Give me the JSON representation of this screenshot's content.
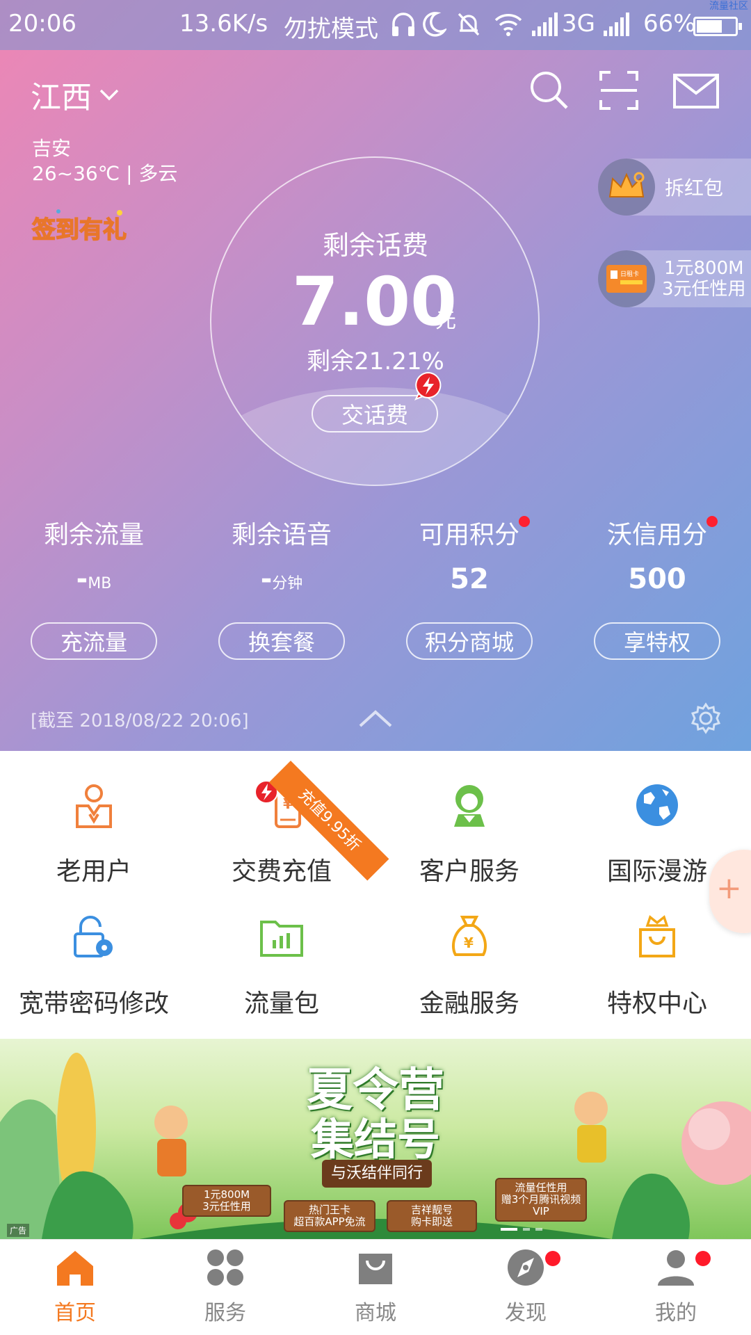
{
  "status_bar": {
    "time": "20:06",
    "net_speed": "13.6K/s",
    "dnd_mode": "勿扰模式",
    "network": "3G",
    "battery_pct": "66%",
    "battery_level": 0.66,
    "corner_tag": "流量社区"
  },
  "header": {
    "province": "江西",
    "city": "吉安",
    "weather": "26~36℃ | 多云",
    "signin_label": "签到有礼"
  },
  "balance": {
    "label": "剩余话费",
    "value": "7.00",
    "unit": "元",
    "remaining": "剩余21.21%",
    "pay_button": "交话费"
  },
  "side_promos": {
    "red_packet": "拆红包",
    "card_line1": "1元800M",
    "card_line2": "3元任性用",
    "card_mini_label": "日租卡"
  },
  "stats": [
    {
      "label": "剩余流量",
      "value": "-",
      "unit": "MB"
    },
    {
      "label": "剩余语音",
      "value": "-",
      "unit": "分钟"
    },
    {
      "label": "可用积分",
      "value": "52",
      "unit": ""
    },
    {
      "label": "沃信用分",
      "value": "500",
      "unit": ""
    }
  ],
  "stat_buttons": [
    "充流量",
    "换套餐",
    "积分商城",
    "享特权"
  ],
  "as_of": "[截至 2018/08/22 20:06]",
  "grid": [
    {
      "label": "老用户",
      "icon": "old-user-icon",
      "color": "#f0803c"
    },
    {
      "label": "交费充值",
      "icon": "phone-recharge-icon",
      "color": "#f0803c"
    },
    {
      "label": "客户服务",
      "icon": "customer-service-icon",
      "color": "#6cc04a"
    },
    {
      "label": "国际漫游",
      "icon": "globe-icon",
      "color": "#3b8fe0"
    },
    {
      "label": "宽带密码修改",
      "icon": "lock-gear-icon",
      "color": "#3b8fe0"
    },
    {
      "label": "流量包",
      "icon": "data-folder-icon",
      "color": "#6cc04a"
    },
    {
      "label": "金融服务",
      "icon": "money-bag-icon",
      "color": "#f3a716"
    },
    {
      "label": "特权中心",
      "icon": "crown-bag-icon",
      "color": "#f3a716"
    }
  ],
  "ribbon": "充值9.95折",
  "banner": {
    "title_line1": "夏令营",
    "title_line2": "集结号",
    "subtitle": "与沃结伴同行",
    "signs": [
      {
        "l1": "1元800M",
        "l2": "3元任性用"
      },
      {
        "l1": "热门王卡",
        "l2": "超百款APP免流"
      },
      {
        "l1": "吉祥靓号",
        "l2": "购卡即送"
      },
      {
        "l1": "流量任性用",
        "l2": "赠3个月腾讯视频VIP"
      }
    ],
    "ad_tag": "广告"
  },
  "tabs": [
    {
      "label": "首页",
      "icon": "home-icon",
      "active": true,
      "badge": false
    },
    {
      "label": "服务",
      "icon": "services-icon",
      "active": false,
      "badge": false
    },
    {
      "label": "商城",
      "icon": "shop-bag-icon",
      "active": false,
      "badge": false
    },
    {
      "label": "发现",
      "icon": "compass-icon",
      "active": false,
      "badge": true
    },
    {
      "label": "我的",
      "icon": "profile-icon",
      "active": false,
      "badge": true
    }
  ],
  "colors": {
    "accent": "#f47920",
    "badge_red": "#ff1a2a"
  }
}
